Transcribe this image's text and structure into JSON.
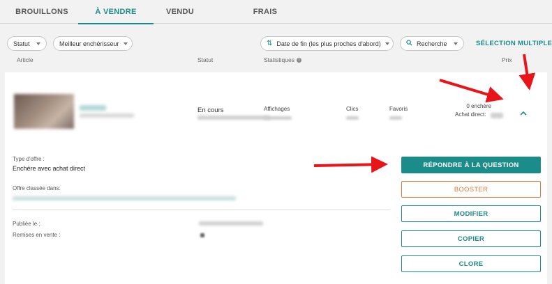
{
  "tabs": [
    {
      "label": "BROUILLONS"
    },
    {
      "label": "À VENDRE"
    },
    {
      "label": "VENDU"
    },
    {
      "label": "FRAIS"
    }
  ],
  "filters": {
    "statut": "Statut",
    "meilleur": "Meilleur enchérisseur",
    "date_fin": "Date de fin (les plus proches d'abord)",
    "recherche": "Recherche",
    "selection_multiple": "SÉLECTION MULTIPLE"
  },
  "columns": {
    "article": "Article",
    "statut": "Statut",
    "statistiques": "Statistiques",
    "prix": "Prix"
  },
  "listing": {
    "status": "En cours",
    "stats": {
      "affichages": "Affichages",
      "clics": "Clics",
      "favoris": "Favoris"
    },
    "price": {
      "encheres": "0 enchère",
      "achat_direct": "Achat direct:"
    }
  },
  "details": {
    "type_offre_label": "Type d'offre :",
    "type_offre_value": "Enchère avec achat direct",
    "classee_label": "Offre classée dans:",
    "publiee_label": "Publiée le :",
    "remises_label": "Remises en vente :"
  },
  "actions": {
    "repondre": "RÉPONDRE À LA QUESTION",
    "booster": "BOOSTER",
    "modifier": "MODIFIER",
    "copier": "COPIER",
    "clore": "CLORE"
  },
  "colors": {
    "accent": "#1a8c8a",
    "booster": "#e07b3a",
    "annotation_arrow": "#e8141a"
  }
}
